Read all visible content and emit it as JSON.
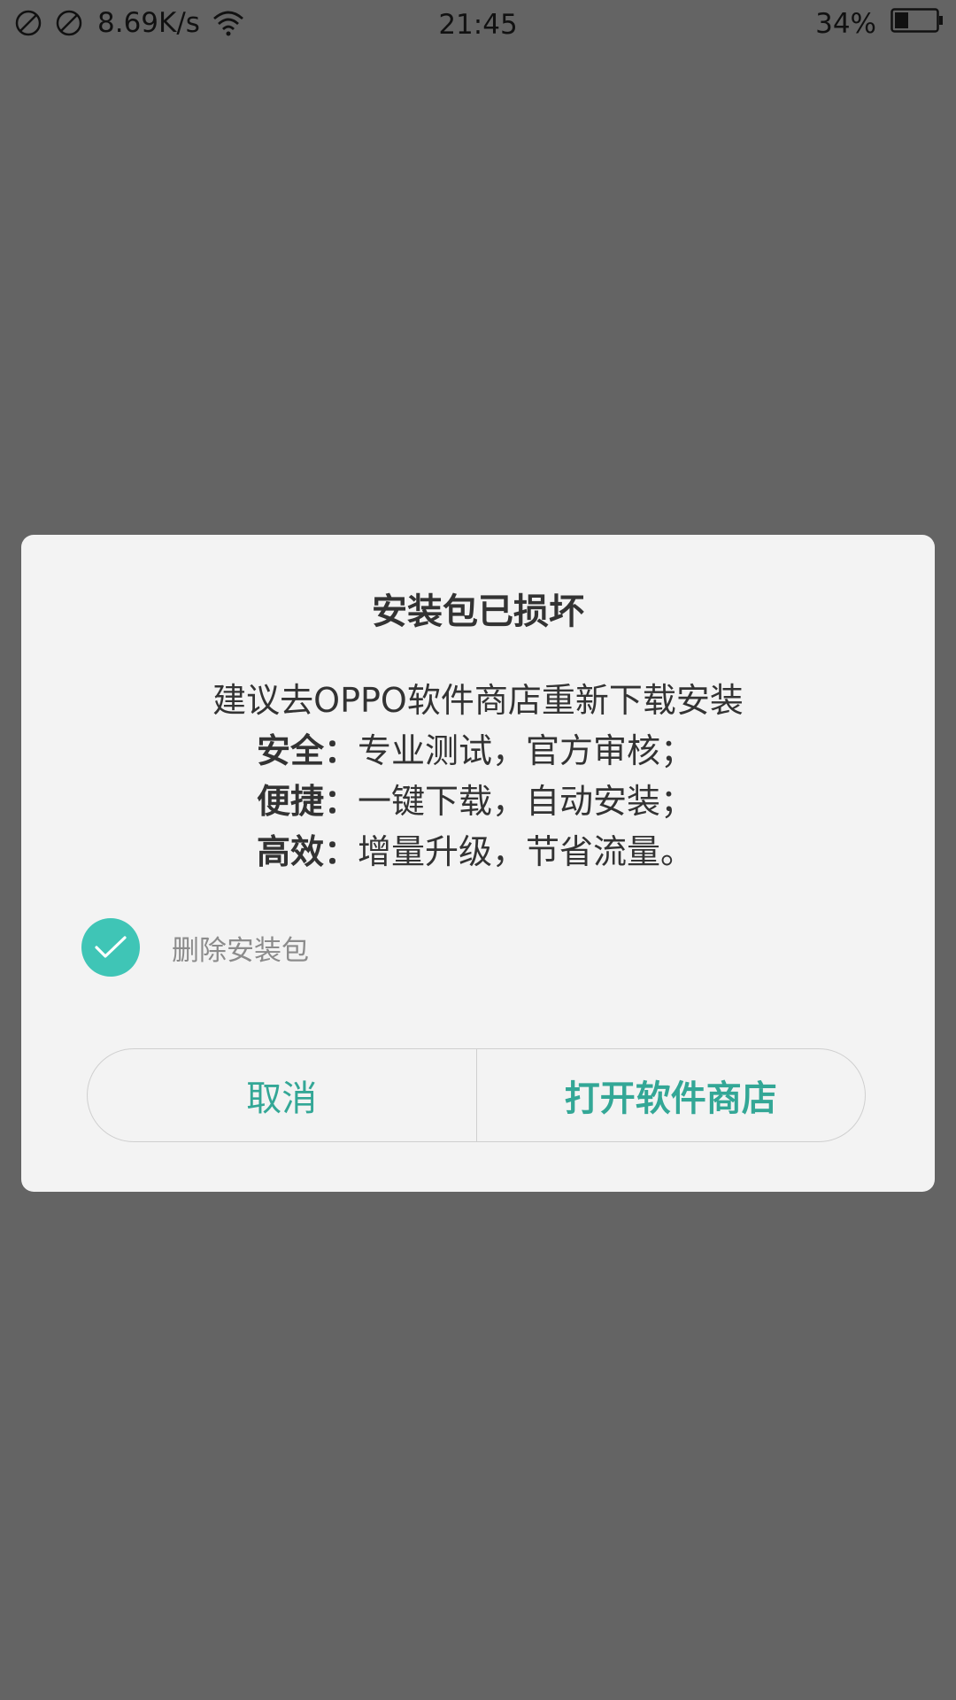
{
  "status_bar": {
    "left_icons": [
      "no-sim-icon",
      "no-sim-icon"
    ],
    "network_speed": "8.69K/s",
    "wifi_icon": "wifi-icon",
    "time": "21:45",
    "battery_percent": "34%",
    "battery_level": 0.34
  },
  "dialog": {
    "title": "安装包已损坏",
    "message": "建议去OPPO软件商店重新下载安装",
    "features": [
      {
        "key": "安全：",
        "value": "专业测试，官方审核；"
      },
      {
        "key": "便捷：",
        "value": "一键下载，自动安装；"
      },
      {
        "key": "高效：",
        "value": "增量升级，节省流量。"
      }
    ],
    "checkbox": {
      "label": "删除安装包",
      "checked": true
    },
    "buttons": {
      "cancel": "取消",
      "open_store": "打开软件商店"
    }
  },
  "colors": {
    "overlay_background": "#646464",
    "dialog_background": "#f3f3f3",
    "accent": "#3fc5b6",
    "button_text": "#33a796"
  }
}
